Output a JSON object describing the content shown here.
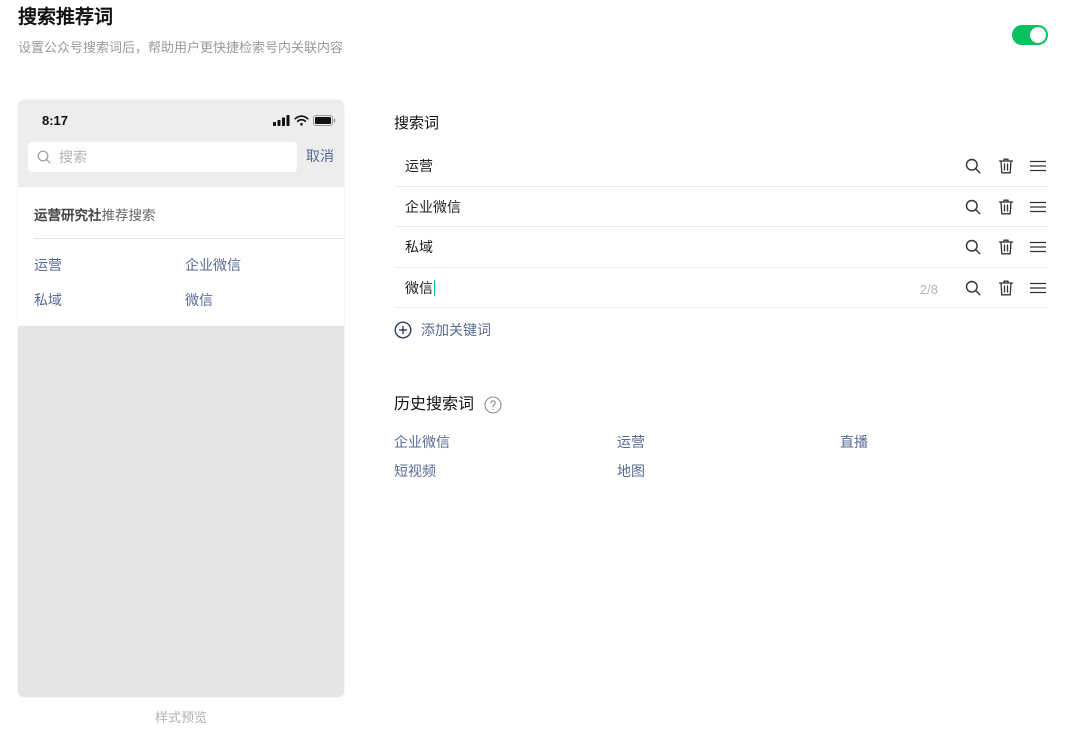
{
  "header": {
    "title": "搜索推荐词",
    "subtitle": "设置公众号搜索词后，帮助用户更快捷检索号内关联内容",
    "toggle_on": true
  },
  "colors": {
    "accent": "#07c160",
    "link": "#576b95"
  },
  "preview": {
    "status_time": "8:17",
    "search_placeholder": "搜索",
    "cancel_label": "取消",
    "account_name": "运营研究社",
    "section_label": "推荐搜索",
    "items": [
      "运营",
      "企业微信",
      "私域",
      "微信"
    ],
    "caption": "样式预览"
  },
  "keywords": {
    "heading": "搜索词",
    "row_action_icons": [
      "search-icon",
      "trash-icon",
      "drag-handle-icon"
    ],
    "items": [
      {
        "text": "运营"
      },
      {
        "text": "企业微信"
      },
      {
        "text": "私域"
      },
      {
        "text": "微信",
        "counter": "2/8",
        "editing": true
      }
    ],
    "add_label": "添加关键词"
  },
  "history": {
    "heading": "历史搜索词",
    "items": [
      "企业微信",
      "运营",
      "直播",
      "短视频",
      "地图"
    ]
  }
}
